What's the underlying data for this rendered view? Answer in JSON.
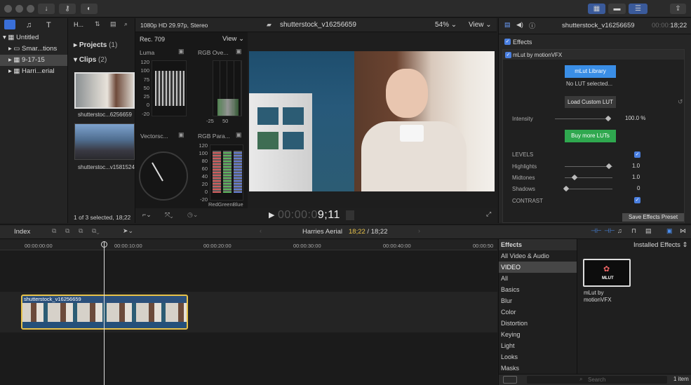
{
  "toolbar": {
    "share_icon": "share-icon"
  },
  "library": {
    "header": "H...",
    "items": [
      {
        "label": "Untitled"
      },
      {
        "label": "Smar...tions"
      },
      {
        "label": "9-17-15"
      },
      {
        "label": "Harri...erial"
      }
    ]
  },
  "browser": {
    "projects_label": "Projects",
    "projects_count": "(1)",
    "clips_label": "Clips",
    "clips_count": "(2)",
    "clips": [
      {
        "name": "shutterstoc...6256659"
      },
      {
        "name": "shutterstoc...v1581524"
      }
    ],
    "status": "1 of 3 selected, 18;22"
  },
  "viewer": {
    "format": "1080p HD 29.97p, Stereo",
    "clip_title": "shutterstock_v16256659",
    "zoom": "54%",
    "view_label": "View",
    "scope_standard": "Rec. 709",
    "scope_view_label": "View",
    "scopes": {
      "luma": {
        "title": "Luma",
        "ticks": [
          "120",
          "100",
          "75",
          "50",
          "25",
          "0",
          "-20"
        ]
      },
      "rgb_overlay": {
        "title": "RGB Ove...",
        "ticks": [
          "-25",
          "50"
        ]
      },
      "vectorscope": {
        "title": "Vectorsc..."
      },
      "rgb_parade": {
        "title": "RGB Para...",
        "ticks": [
          "120",
          "100",
          "80",
          "60",
          "40",
          "20",
          "0",
          "-20"
        ],
        "channels": [
          "Red",
          "Green",
          "Blue"
        ]
      }
    },
    "timecode_dim": "00:00:0",
    "timecode_bright": "9;11"
  },
  "inspector": {
    "title": "shutterstock_v16256659",
    "duration_dim": "00:00:",
    "duration": "18;22",
    "effects_label": "Effects",
    "effect_name": "mLut by motionVFX",
    "library_button": "mLut Library",
    "no_lut": "No LUT selected...",
    "load_button": "Load Custom LUT",
    "intensity_label": "Intensity",
    "intensity_value": "100.0",
    "intensity_unit": "%",
    "buy_button": "Buy more LUTs",
    "levels_label": "LEVELS",
    "highlights_label": "Highlights",
    "highlights_value": "1.0",
    "midtones_label": "Midtones",
    "midtones_value": "1.0",
    "shadows_label": "Shadows",
    "shadows_value": "0",
    "contrast_label": "CONTRAST",
    "save_preset": "Save Effects Preset"
  },
  "timeline": {
    "index_label": "Index",
    "project_name": "Harries Aerial",
    "position": "18;22",
    "duration": "/ 18;22",
    "ruler": [
      "00:00:00:00",
      "00:00:10:00",
      "00:00:20:00",
      "00:00:30:00",
      "00:00:40:00",
      "00:00:50"
    ],
    "clip_name": "shutterstock_v16256659"
  },
  "effects_browser": {
    "title": "Effects",
    "installed_label": "Installed Effects",
    "categories": [
      "All Video & Audio",
      "VIDEO",
      "All",
      "Basics",
      "Blur",
      "Color",
      "Distortion",
      "Keying",
      "Light",
      "Looks",
      "Masks"
    ],
    "selected_category": "VIDEO",
    "item_name_line1": "mLut by",
    "item_name_line2": "motionVFX",
    "logo_text": "MLUT",
    "search_placeholder": "Search",
    "count": "1 item"
  },
  "colors": {
    "accent_blue": "#3a8ee6",
    "green": "#2fa84f",
    "clip_yellow": "#e7c24a",
    "timecode_yellow": "#e7c24a"
  }
}
